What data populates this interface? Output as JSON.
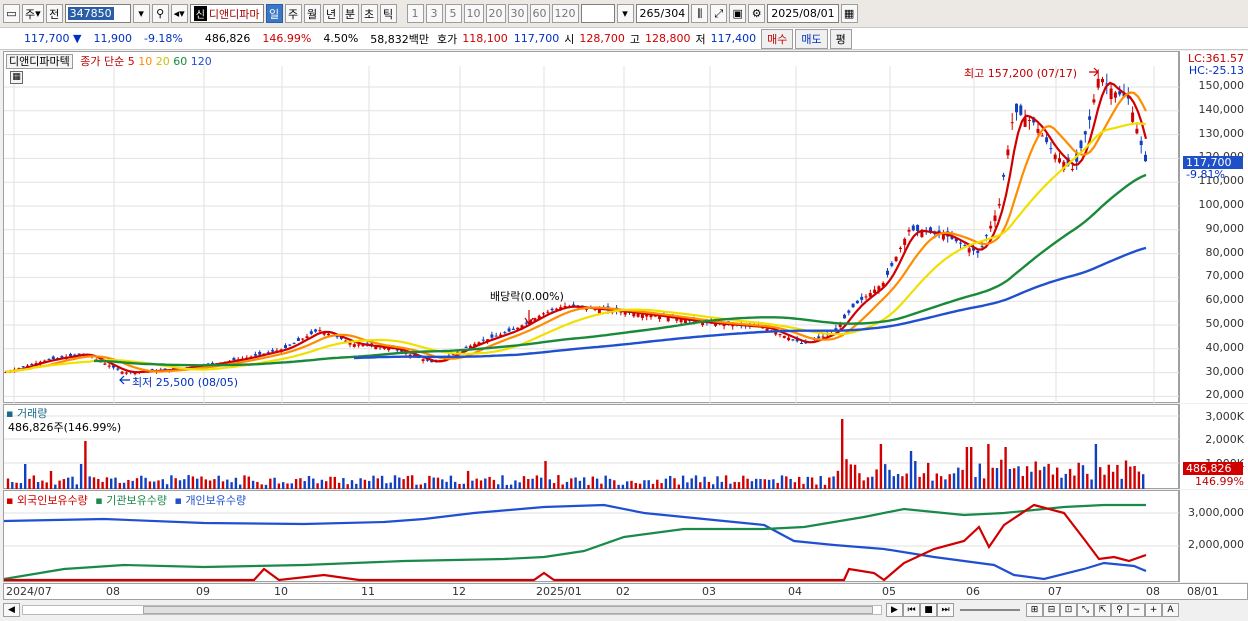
{
  "toolbar": {
    "market": "주",
    "prev": "전",
    "stock_code": "347850",
    "stock_name": "디앤디파마",
    "credit_badge": "신",
    "periods": [
      "일",
      "주",
      "월",
      "년",
      "분",
      "초",
      "틱"
    ],
    "active_period": "일",
    "intervals": [
      "1",
      "3",
      "5",
      "10",
      "20",
      "30",
      "60",
      "120"
    ],
    "count": "265",
    "total": "/304",
    "date": "2025/08/01"
  },
  "quote": {
    "price": "117,700",
    "arrow": "▼",
    "change": "11,900",
    "change_pct": "-9.18%",
    "volume": "486,826",
    "volume_pct": "146.99%",
    "turnover": "4.50%",
    "amount": "58,832백만",
    "bid_label": "호가",
    "bid": "118,100",
    "ask": "117,700",
    "open_label": "시",
    "open": "128,700",
    "high_label": "고",
    "high": "128,800",
    "low_label": "저",
    "low": "117,400",
    "buy": "매수",
    "sell": "매도",
    "eval": "평"
  },
  "price_panel": {
    "title": "디앤디파마텍",
    "ma_label": "종가 단순",
    "ma_periods": [
      "5",
      "10",
      "20",
      "60",
      "120"
    ],
    "ma_colors": [
      "#d00000",
      "#ff8c00",
      "#f0e000",
      "#1a8a3a",
      "#2050d0"
    ],
    "lc": "LC:361.57",
    "hc": "HC:-25.13",
    "y_ticks": [
      "150,000",
      "140,000",
      "130,000",
      "120,000",
      "110,000",
      "100,000",
      "90,000",
      "80,000",
      "70,000",
      "60,000",
      "50,000",
      "40,000",
      "30,000",
      "20,000"
    ],
    "last_price": "117,700",
    "last_pct": "-9.81%",
    "high_annot": "최고 157,200 (07/17)",
    "low_annot": "최저 25,500 (08/05)",
    "dividend_annot": "배당락(0.00%)"
  },
  "volume_panel": {
    "title": "거래량",
    "value": "486,826주(146.99%)",
    "y_ticks": [
      "3,000K",
      "2,000K",
      "1,000K"
    ],
    "last": "486,826",
    "last_pct": "146.99%"
  },
  "holdings_panel": {
    "series": [
      "외국인보유수량",
      "기관보유수량",
      "개인보유수량"
    ],
    "colors": [
      "#d00000",
      "#1a8a4a",
      "#2050d0"
    ],
    "y_ticks": [
      "3,000,000",
      "2,000,000"
    ]
  },
  "x_axis": {
    "labels": [
      "2024/07",
      "08",
      "09",
      "10",
      "11",
      "12",
      "2025/01",
      "02",
      "03",
      "04",
      "05",
      "06",
      "07",
      "08"
    ],
    "right": "08/01"
  }
}
